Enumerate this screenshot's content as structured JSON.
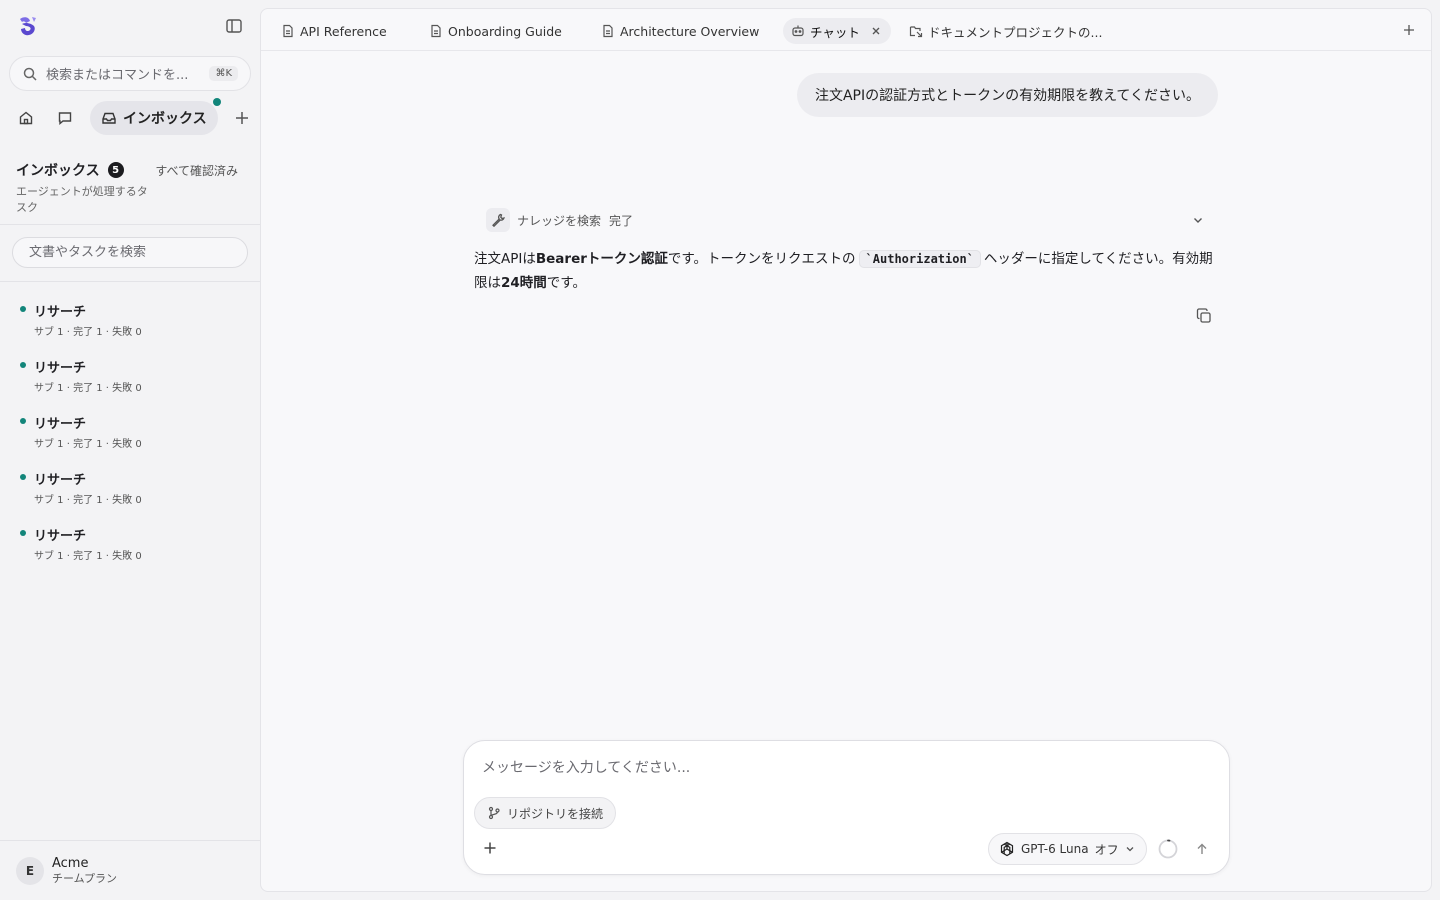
{
  "sidebar": {
    "search_placeholder": "検索またはコマンドを...",
    "search_shortcut": "⌘K",
    "nav": {
      "inbox_label": "インボックス"
    },
    "inbox": {
      "title": "インボックス",
      "count": "5",
      "mark_all_read": "すべて確認済み",
      "subtitle": "エージェントが処理するタスク",
      "filter_placeholder": "文書やタスクを検索"
    },
    "tasks": [
      {
        "title": "リサーチ",
        "meta": "サブ 1 · 完了 1 · 失敗 0"
      },
      {
        "title": "リサーチ",
        "meta": "サブ 1 · 完了 1 · 失敗 0"
      },
      {
        "title": "リサーチ",
        "meta": "サブ 1 · 完了 1 · 失敗 0"
      },
      {
        "title": "リサーチ",
        "meta": "サブ 1 · 完了 1 · 失敗 0"
      },
      {
        "title": "リサーチ",
        "meta": "サブ 1 · 完了 1 · 失敗 0"
      }
    ],
    "account": {
      "initial": "E",
      "name": "Acme",
      "plan": "チームプラン"
    }
  },
  "tabs": [
    {
      "label": "API Reference",
      "icon": "document-icon"
    },
    {
      "label": "Onboarding Guide",
      "icon": "document-icon"
    },
    {
      "label": "Architecture Overview",
      "icon": "document-icon"
    },
    {
      "label": "チャット",
      "icon": "bot-icon",
      "active": true
    },
    {
      "label": "ドキュメントプロジェクトの...",
      "icon": "folder-link-icon"
    }
  ],
  "chat": {
    "user_message": "注文APIの認証方式とトークンの有効期限を教えてください。",
    "tool": {
      "name": "ナレッジを検索",
      "status": "完了"
    },
    "answer": {
      "p1": "注文APIは",
      "b1": "Bearerトークン認証",
      "p2": "です。トークンをリクエストの",
      "code": "`Authorization`",
      "p3": "ヘッダーに指定してください。有効期限は",
      "b2": "24時間",
      "p4": "です。"
    }
  },
  "composer": {
    "placeholder": "メッセージを入力してください...",
    "repo_chip": "リポジトリを接続",
    "model": "GPT-6 Luna",
    "mode": "オフ"
  },
  "colors": {
    "accent_dot": "#12857a",
    "brand_logo": "#6b5bd6"
  }
}
